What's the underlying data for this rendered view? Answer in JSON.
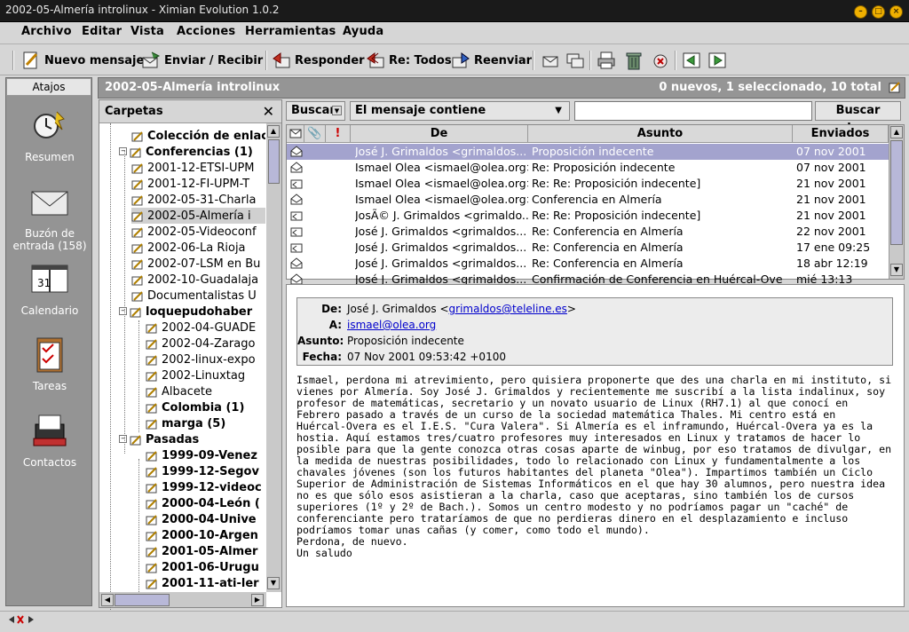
{
  "window": {
    "title": "2002-05-Almería introlinux - Ximian Evolution 1.0.2"
  },
  "menu": [
    "Archivo",
    "Editar",
    "Vista",
    "Acciones",
    "Herramientas",
    "Ayuda"
  ],
  "toolbar": {
    "new_message": "Nuevo mensaje",
    "send_receive": "Enviar / Recibir",
    "reply": "Responder",
    "reply_all": "Re: Todos",
    "forward": "Reenviar"
  },
  "shortcuts": {
    "header": "Atajos",
    "items": [
      "Resumen",
      "Buzón de entrada (158)",
      "Calendario",
      "Tareas",
      "Contactos"
    ]
  },
  "folder_bar": {
    "name": "2002-05-Almería introlinux",
    "counts": "0 nuevos, 1 seleccionado, 10 total"
  },
  "folders": {
    "header": "Carpetas",
    "items": [
      "Colección de enlac",
      "Conferencias (1)",
      "2001-12-ETSI-UPM",
      "2001-12-FI-UPM-T",
      "2002-05-31-Charla",
      "2002-05-Almería i",
      "2002-05-Videoconf",
      "2002-06-La Rioja",
      "2002-07-LSM en Bu",
      "2002-10-Guadalaja",
      "Documentalistas U",
      "loquepudohaber",
      "2002-04-GUADE",
      "2002-04-Zarago",
      "2002-linux-expo",
      "2002-Linuxtag",
      "Albacete",
      "Colombia (1)",
      "marga (5)",
      "Pasadas",
      "1999-09-Venez",
      "1999-12-Segov",
      "1999-12-videoc",
      "2000-04-León (",
      "2000-04-Unive",
      "2000-10-Argen",
      "2001-05-Almer",
      "2001-06-Urugu",
      "2001-11-ati-ler"
    ]
  },
  "search": {
    "scope": "Buscar",
    "criteria": "El mensaje contiene",
    "value": "",
    "button": "Buscar ahora"
  },
  "columns": {
    "from": "De",
    "subject": "Asunto",
    "sent": "Enviados"
  },
  "messages": [
    {
      "from": "José J. Grimaldos <grimaldos...",
      "subject": "Proposición indecente",
      "date": "07 nov 2001"
    },
    {
      "from": "Ismael Olea <ismael@olea.org>",
      "subject": "Re: Proposición indecente",
      "date": "07 nov 2001"
    },
    {
      "from": "Ismael Olea <ismael@olea.org>",
      "subject": "Re: Re: Proposición indecente]",
      "date": "21 nov 2001"
    },
    {
      "from": "Ismael Olea <ismael@olea.org>",
      "subject": "Conferencia en Almería",
      "date": "21 nov 2001"
    },
    {
      "from": "JosÃ© J. Grimaldos <grimaldo...",
      "subject": "Re: Re: Proposición indecente]",
      "date": "21 nov 2001"
    },
    {
      "from": "José J. Grimaldos <grimaldos...",
      "subject": "Re: Conferencia en Almería",
      "date": "22 nov 2001"
    },
    {
      "from": "José J. Grimaldos <grimaldos...",
      "subject": "Re: Conferencia en Almería",
      "date": "17 ene 09:25"
    },
    {
      "from": "José J. Grimaldos <grimaldos...",
      "subject": "Re: Conferencia en Almería",
      "date": "18 abr 12:19"
    },
    {
      "from": "José J. Grimaldos <grimaldos...",
      "subject": "Confirmación de Conferencia en Huércal-Ove",
      "date": "mié 13:13"
    }
  ],
  "preview": {
    "labels": {
      "from": "De:",
      "to": "A:",
      "subject": "Asunto:",
      "date": "Fecha:"
    },
    "from_name": "José J. Grimaldos <",
    "from_email": "grimaldos@teleline.es",
    "from_tail": ">",
    "to": "ismael@olea.org",
    "subject": "Proposición indecente",
    "date": "07 Nov 2001 09:53:42 +0100",
    "body": "Ismael, perdona mi atrevimiento, pero quisiera proponerte que des una charla en mi instituto, si\nvienes por Almería. Soy José J. Grimaldos y recientemente me suscribí a la lista indalinux, soy\nprofesor de matemáticas, secretario y un novato usuario de Linux (RH7.1) al que conocí en\nFebrero pasado a través de un curso de la sociedad matemática Thales. Mi centro está en\nHuércal-Overa es el I.E.S. \"Cura Valera\". Si Almería es el inframundo, Huércal-Overa ya es la\nhostia. Aquí estamos tres/cuatro profesores muy interesados en Linux y tratamos de hacer lo\nposible para que la gente conozca otras cosas aparte de winbug, por eso tratamos de divulgar, en\nla medida de nuestras posibilidades, todo lo relacionado con Linux y fundamentalmente a los\nchavales jóvenes (son los futuros habitantes del planeta \"Olea\"). Impartimos también un Ciclo\nSuperior de Administración de Sistemas Informáticos en el que hay 30 alumnos, pero nuestra idea\nno es que sólo esos asistieran a la charla, caso que aceptaras, sino también los de cursos\nsuperiores (1º y 2º de Bach.). Somos un centro modesto y no podríamos pagar un \"caché\" de\nconferenciante pero trataríamos de que no perdieras dinero en el desplazamiento e incluso\npodríamos tomar unas cañas (y comer, como todo el mundo).\nPerdona, de nuevo.\nUn saludo"
  }
}
